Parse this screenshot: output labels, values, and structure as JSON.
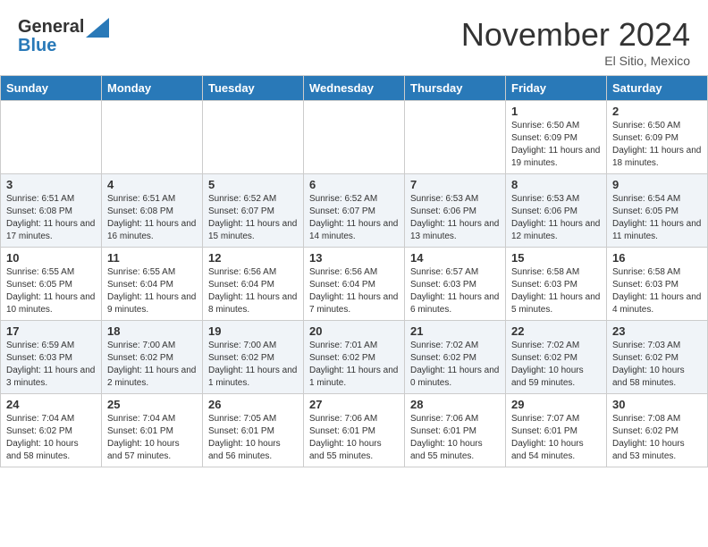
{
  "header": {
    "logo_line1": "General",
    "logo_line2": "Blue",
    "month": "November 2024",
    "location": "El Sitio, Mexico"
  },
  "weekdays": [
    "Sunday",
    "Monday",
    "Tuesday",
    "Wednesday",
    "Thursday",
    "Friday",
    "Saturday"
  ],
  "weeks": [
    [
      {
        "day": "",
        "info": ""
      },
      {
        "day": "",
        "info": ""
      },
      {
        "day": "",
        "info": ""
      },
      {
        "day": "",
        "info": ""
      },
      {
        "day": "",
        "info": ""
      },
      {
        "day": "1",
        "info": "Sunrise: 6:50 AM\nSunset: 6:09 PM\nDaylight: 11 hours and 19 minutes."
      },
      {
        "day": "2",
        "info": "Sunrise: 6:50 AM\nSunset: 6:09 PM\nDaylight: 11 hours and 18 minutes."
      }
    ],
    [
      {
        "day": "3",
        "info": "Sunrise: 6:51 AM\nSunset: 6:08 PM\nDaylight: 11 hours and 17 minutes."
      },
      {
        "day": "4",
        "info": "Sunrise: 6:51 AM\nSunset: 6:08 PM\nDaylight: 11 hours and 16 minutes."
      },
      {
        "day": "5",
        "info": "Sunrise: 6:52 AM\nSunset: 6:07 PM\nDaylight: 11 hours and 15 minutes."
      },
      {
        "day": "6",
        "info": "Sunrise: 6:52 AM\nSunset: 6:07 PM\nDaylight: 11 hours and 14 minutes."
      },
      {
        "day": "7",
        "info": "Sunrise: 6:53 AM\nSunset: 6:06 PM\nDaylight: 11 hours and 13 minutes."
      },
      {
        "day": "8",
        "info": "Sunrise: 6:53 AM\nSunset: 6:06 PM\nDaylight: 11 hours and 12 minutes."
      },
      {
        "day": "9",
        "info": "Sunrise: 6:54 AM\nSunset: 6:05 PM\nDaylight: 11 hours and 11 minutes."
      }
    ],
    [
      {
        "day": "10",
        "info": "Sunrise: 6:55 AM\nSunset: 6:05 PM\nDaylight: 11 hours and 10 minutes."
      },
      {
        "day": "11",
        "info": "Sunrise: 6:55 AM\nSunset: 6:04 PM\nDaylight: 11 hours and 9 minutes."
      },
      {
        "day": "12",
        "info": "Sunrise: 6:56 AM\nSunset: 6:04 PM\nDaylight: 11 hours and 8 minutes."
      },
      {
        "day": "13",
        "info": "Sunrise: 6:56 AM\nSunset: 6:04 PM\nDaylight: 11 hours and 7 minutes."
      },
      {
        "day": "14",
        "info": "Sunrise: 6:57 AM\nSunset: 6:03 PM\nDaylight: 11 hours and 6 minutes."
      },
      {
        "day": "15",
        "info": "Sunrise: 6:58 AM\nSunset: 6:03 PM\nDaylight: 11 hours and 5 minutes."
      },
      {
        "day": "16",
        "info": "Sunrise: 6:58 AM\nSunset: 6:03 PM\nDaylight: 11 hours and 4 minutes."
      }
    ],
    [
      {
        "day": "17",
        "info": "Sunrise: 6:59 AM\nSunset: 6:03 PM\nDaylight: 11 hours and 3 minutes."
      },
      {
        "day": "18",
        "info": "Sunrise: 7:00 AM\nSunset: 6:02 PM\nDaylight: 11 hours and 2 minutes."
      },
      {
        "day": "19",
        "info": "Sunrise: 7:00 AM\nSunset: 6:02 PM\nDaylight: 11 hours and 1 minutes."
      },
      {
        "day": "20",
        "info": "Sunrise: 7:01 AM\nSunset: 6:02 PM\nDaylight: 11 hours and 1 minute."
      },
      {
        "day": "21",
        "info": "Sunrise: 7:02 AM\nSunset: 6:02 PM\nDaylight: 11 hours and 0 minutes."
      },
      {
        "day": "22",
        "info": "Sunrise: 7:02 AM\nSunset: 6:02 PM\nDaylight: 10 hours and 59 minutes."
      },
      {
        "day": "23",
        "info": "Sunrise: 7:03 AM\nSunset: 6:02 PM\nDaylight: 10 hours and 58 minutes."
      }
    ],
    [
      {
        "day": "24",
        "info": "Sunrise: 7:04 AM\nSunset: 6:02 PM\nDaylight: 10 hours and 58 minutes."
      },
      {
        "day": "25",
        "info": "Sunrise: 7:04 AM\nSunset: 6:01 PM\nDaylight: 10 hours and 57 minutes."
      },
      {
        "day": "26",
        "info": "Sunrise: 7:05 AM\nSunset: 6:01 PM\nDaylight: 10 hours and 56 minutes."
      },
      {
        "day": "27",
        "info": "Sunrise: 7:06 AM\nSunset: 6:01 PM\nDaylight: 10 hours and 55 minutes."
      },
      {
        "day": "28",
        "info": "Sunrise: 7:06 AM\nSunset: 6:01 PM\nDaylight: 10 hours and 55 minutes."
      },
      {
        "day": "29",
        "info": "Sunrise: 7:07 AM\nSunset: 6:01 PM\nDaylight: 10 hours and 54 minutes."
      },
      {
        "day": "30",
        "info": "Sunrise: 7:08 AM\nSunset: 6:02 PM\nDaylight: 10 hours and 53 minutes."
      }
    ]
  ]
}
